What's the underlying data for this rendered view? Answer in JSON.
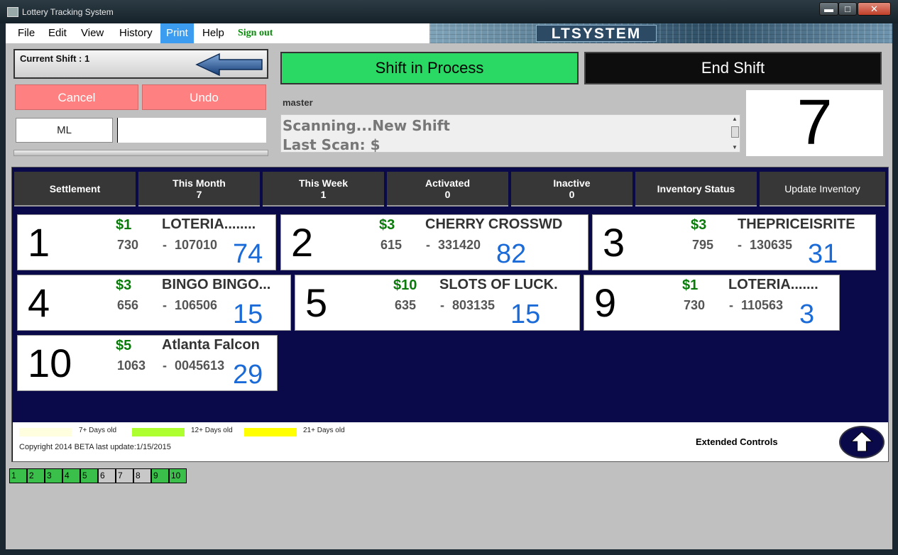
{
  "window": {
    "title": "Lottery Tracking System",
    "min": "▬",
    "max": "□",
    "close": "✕"
  },
  "menu": {
    "file": "File",
    "edit": "Edit",
    "view": "View",
    "history": "History",
    "print": "Print",
    "help": "Help",
    "sign_out": "Sign out"
  },
  "banner": {
    "logo": "LTSYSTEM"
  },
  "shift": {
    "current_label": "Current Shift : 1"
  },
  "buttons": {
    "cancel": "Cancel",
    "undo": "Undo",
    "ml": "ML",
    "shift_in_process": "Shift in Process",
    "end_shift": "End Shift"
  },
  "scan": {
    "user": "master",
    "line1": "Scanning...New Shift",
    "line2": "Last Scan: $",
    "input_value": "",
    "count": "7"
  },
  "header": [
    {
      "label": "Settlement",
      "value": ""
    },
    {
      "label": "This Month",
      "value": "7"
    },
    {
      "label": "This Week",
      "value": "1"
    },
    {
      "label": "Activated",
      "value": "0"
    },
    {
      "label": "Inactive",
      "value": "0"
    },
    {
      "label": "Inventory Status",
      "value": ""
    },
    {
      "label": "Update Inventory",
      "value": ""
    }
  ],
  "cards": [
    {
      "slot": "1",
      "price": "$1",
      "name": "LOTERIA........",
      "game": "730",
      "dash": "-",
      "pack": "107010",
      "count": "74"
    },
    {
      "slot": "2",
      "price": "$3",
      "name": "CHERRY CROSSWD",
      "game": "615",
      "dash": "-",
      "pack": "331420",
      "count": "82"
    },
    {
      "slot": "3",
      "price": "$3",
      "name": "THEPRICEISRITE",
      "game": "795",
      "dash": "-",
      "pack": "130635",
      "count": "31"
    },
    {
      "slot": "4",
      "price": "$3",
      "name": "BINGO BINGO...",
      "game": "656",
      "dash": "-",
      "pack": "106506",
      "count": "15"
    },
    {
      "slot": "5",
      "price": "$10",
      "name": "SLOTS OF LUCK.",
      "game": "635",
      "dash": "-",
      "pack": "803135",
      "count": "15"
    },
    {
      "slot": "9",
      "price": "$1",
      "name": "LOTERIA.......",
      "game": "730",
      "dash": "-",
      "pack": "110563",
      "count": "3"
    },
    {
      "slot": "10",
      "price": "$5",
      "name": "Atlanta Falcon",
      "game": "1063",
      "dash": "-",
      "pack": "0045613",
      "count": "29"
    }
  ],
  "legend": [
    {
      "label": "7+ Days old",
      "color": "#ffffe0"
    },
    {
      "label": "12+ Days old",
      "color": "#adff2f"
    },
    {
      "label": "21+ Days old",
      "color": "#ffff00"
    }
  ],
  "footer": {
    "copyright": "Copyright 2014 BETA last update:1/15/2015",
    "extended": "Extended Controls"
  },
  "pages": [
    {
      "label": "1",
      "status": "green"
    },
    {
      "label": "2",
      "status": "green"
    },
    {
      "label": "3",
      "status": "green"
    },
    {
      "label": "4",
      "status": "green"
    },
    {
      "label": "5",
      "status": "green"
    },
    {
      "label": "6",
      "status": "gray"
    },
    {
      "label": "7",
      "status": "gray"
    },
    {
      "label": "8",
      "status": "gray"
    },
    {
      "label": "9",
      "status": "green"
    },
    {
      "label": "10",
      "status": "green"
    }
  ],
  "colors": {
    "accent_green": "#2ad864",
    "cancel_red": "#ff8080",
    "panel_navy": "#0a0a4a",
    "count_blue": "#1a6ad8",
    "price_green": "#0a7a0a"
  }
}
